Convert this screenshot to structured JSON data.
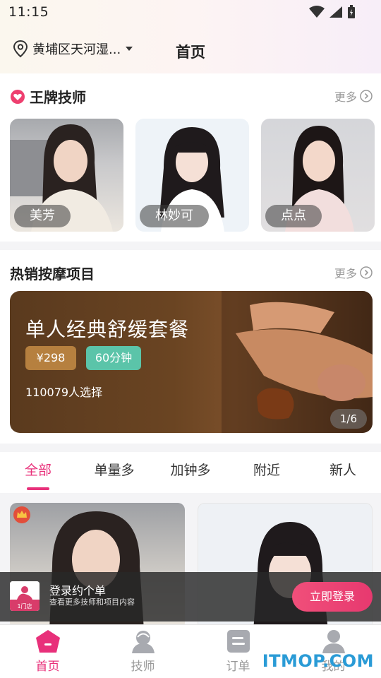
{
  "status_bar": {
    "time": "11:15"
  },
  "header": {
    "location": "黄埔区天河湿...",
    "title": "首页"
  },
  "star_section": {
    "title": "王牌技师",
    "more_label": "更多",
    "technicians": [
      {
        "name": "美芳"
      },
      {
        "name": "林妙可"
      },
      {
        "name": "点点"
      }
    ]
  },
  "hot_section": {
    "title": "热销按摩项目",
    "more_label": "更多",
    "banner": {
      "title": "单人经典舒缓套餐",
      "price": "¥298",
      "duration": "60分钟",
      "sold": "110079人选择",
      "pager": "1/6"
    }
  },
  "tabs": [
    {
      "label": "全部",
      "active": true
    },
    {
      "label": "单量多",
      "active": false
    },
    {
      "label": "加钟多",
      "active": false
    },
    {
      "label": "附近",
      "active": false
    },
    {
      "label": "新人",
      "active": false
    }
  ],
  "login_bar": {
    "logo_text": "1门店",
    "title": "登录约个单",
    "subtitle": "查看更多技师和项目内容",
    "button": "立即登录"
  },
  "bottom_nav": [
    {
      "label": "首页",
      "active": true,
      "icon": "home-icon"
    },
    {
      "label": "技师",
      "active": false,
      "icon": "technician-icon"
    },
    {
      "label": "订单",
      "active": false,
      "icon": "order-icon"
    },
    {
      "label": "我的",
      "active": false,
      "icon": "profile-icon"
    }
  ],
  "watermark": "ITMOP.COM",
  "colors": {
    "accent": "#e8307a",
    "price": "#b6803f",
    "duration": "#5bc4a9"
  }
}
